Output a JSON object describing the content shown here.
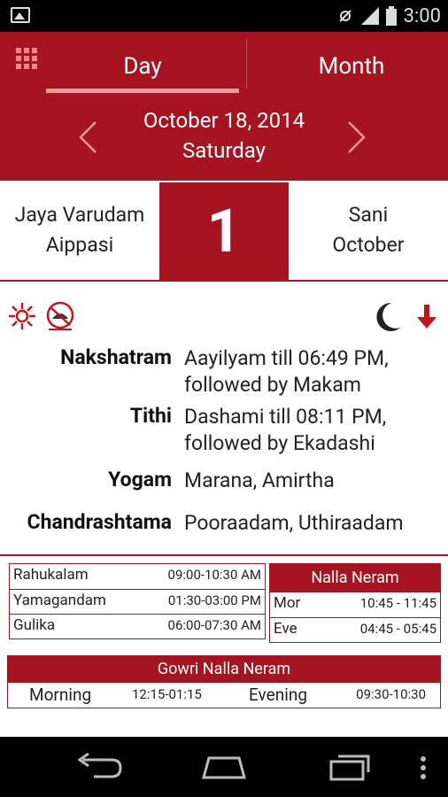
{
  "status_bar": {
    "time": "3:00"
  },
  "tabs": [
    {
      "label": "Day"
    },
    {
      "label": "Month"
    }
  ],
  "date": {
    "line1": "October 18, 2014",
    "line2": "Saturday"
  },
  "day_panel": {
    "left": {
      "line1": "Jaya Varudam",
      "line2": "Aippasi"
    },
    "day_number": "1",
    "right": {
      "line1": "Sani",
      "line2": "October"
    }
  },
  "icons": [
    "sun-icon",
    "no-travel-icon",
    "moon-icon",
    "arrow-down-icon",
    "grid-menu-icon",
    "chevron-left-icon",
    "chevron-right-icon"
  ],
  "details": [
    {
      "label": "Nakshatram",
      "value_line1": "Aayilyam till 06:49 PM,",
      "value_line2": "followed by Makam"
    },
    {
      "label": "Tithi",
      "value_line1": "Dashami till 08:11 PM,",
      "value_line2": "followed by Ekadashi"
    },
    {
      "label": "Yogam",
      "value_line1": "Marana, Amirtha",
      "value_line2": ""
    },
    {
      "label": "Chandrashtama",
      "value_line1": "Pooraadam, Uthiraadam",
      "value_line2": ""
    }
  ],
  "bad_times": [
    {
      "name": "Rahukalam",
      "time": "09:00-10:30 AM"
    },
    {
      "name": "Yamagandam",
      "time": "01:30-03:00 PM"
    },
    {
      "name": "Gulika",
      "time": "06:00-07:30 AM"
    }
  ],
  "nalla_neram": {
    "title": "Nalla Neram",
    "rows": [
      {
        "name": "Mor",
        "time": "10:45 - 11:45"
      },
      {
        "name": "Eve",
        "time": "04:45 - 05:45"
      }
    ]
  },
  "gowri": {
    "title": "Gowri Nalla Neram",
    "morning_label": "Morning",
    "morning_time": "12:15-01:15",
    "evening_label": "Evening",
    "evening_time": "09:30-10:30"
  },
  "colors": {
    "primary": "#a51420",
    "tab_indicator": "#f29a9a"
  }
}
